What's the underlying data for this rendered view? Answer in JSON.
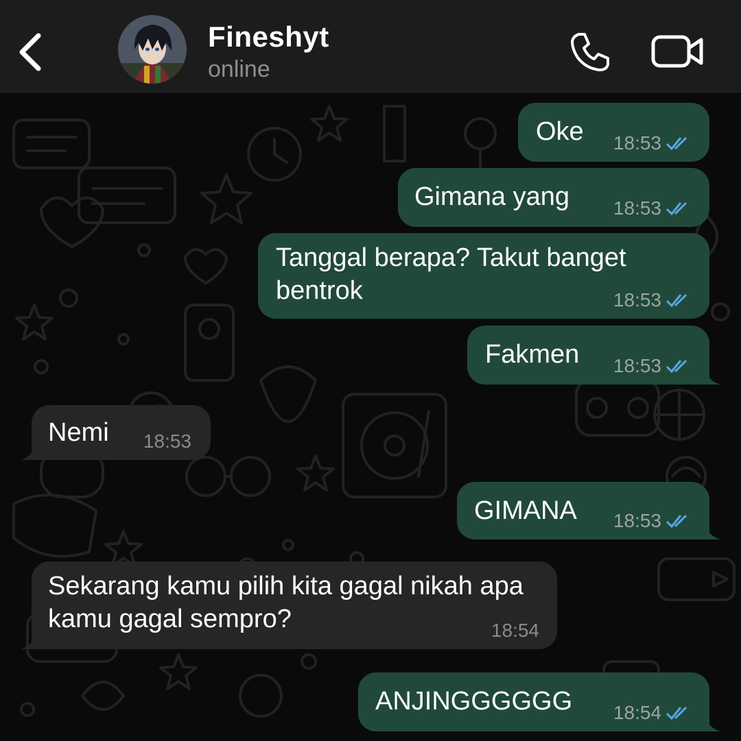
{
  "header": {
    "contact_name": "Fineshyt",
    "status": "online",
    "back_icon": "chevron-left-icon",
    "call_icon": "phone-icon",
    "video_icon": "video-camera-icon"
  },
  "colors": {
    "header_bg": "#1c1c1c",
    "chat_bg": "#0a0a0a",
    "outgoing_bubble": "#21493a",
    "incoming_bubble": "#262626",
    "read_ticks": "#5aa7e8"
  },
  "messages": [
    {
      "direction": "out",
      "text": "Oke",
      "time": "18:53",
      "read": true
    },
    {
      "direction": "out",
      "text": "Gimana yang",
      "time": "18:53",
      "read": true
    },
    {
      "direction": "out",
      "text": "Tanggal berapa? Takut banget bentrok",
      "time": "18:53",
      "read": true
    },
    {
      "direction": "out",
      "text": "Fakmen",
      "time": "18:53",
      "read": true
    },
    {
      "direction": "in",
      "text": "Nemi",
      "time": "18:53"
    },
    {
      "direction": "out",
      "text": "GIMANA",
      "time": "18:53",
      "read": true
    },
    {
      "direction": "in",
      "text": "Sekarang kamu pilih kita gagal nikah apa kamu gagal sempro?",
      "time": "18:54"
    },
    {
      "direction": "out",
      "text": "ANJINGGGGGG",
      "time": "18:54",
      "read": true
    }
  ]
}
